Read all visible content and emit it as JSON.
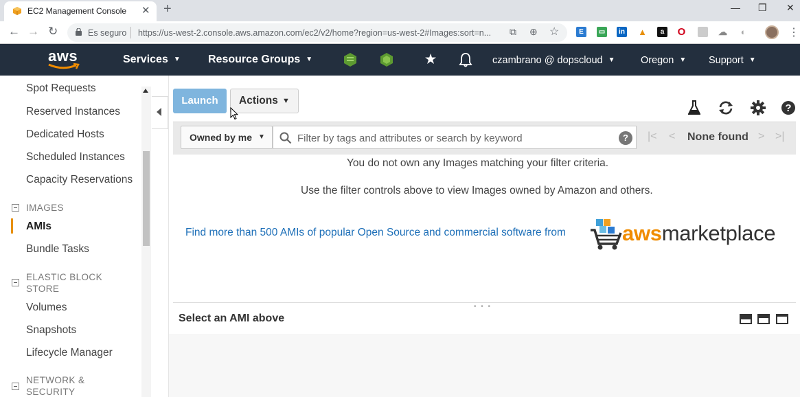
{
  "browser": {
    "tab_title": "EC2 Management Console",
    "tab_close": "✕",
    "new_tab": "+",
    "minimize": "—",
    "restore": "❐",
    "close": "✕",
    "secure_label": "Es seguro",
    "url": "https://us-west-2.console.aws.amazon.com/ec2/v2/home?region=us-west-2#Images:sort=n..."
  },
  "aws_nav": {
    "logo": "aws",
    "services": "Services",
    "resource_groups": "Resource Groups",
    "account": "czambrano @ dopscloud",
    "region": "Oregon",
    "support": "Support"
  },
  "sidebar": {
    "items_top": [
      {
        "label": "Spot Requests"
      },
      {
        "label": "Reserved Instances"
      },
      {
        "label": "Dedicated Hosts"
      },
      {
        "label": "Scheduled Instances"
      },
      {
        "label": "Capacity Reservations"
      }
    ],
    "images_section": "IMAGES",
    "images_items": [
      {
        "label": "AMIs"
      },
      {
        "label": "Bundle Tasks"
      }
    ],
    "ebs_section_line1": "ELASTIC BLOCK",
    "ebs_section_line2": "STORE",
    "ebs_items": [
      {
        "label": "Volumes"
      },
      {
        "label": "Snapshots"
      },
      {
        "label": "Lifecycle Manager"
      }
    ],
    "network_section_line1": "NETWORK &",
    "network_section_line2": "SECURITY"
  },
  "main": {
    "launch_label": "Launch",
    "actions_label": "Actions",
    "filter_owned": "Owned by me",
    "search_placeholder": "Filter by tags and attributes or search by keyword",
    "help_glyph": "?",
    "pager_status": "None found",
    "empty_line1": "You do not own any Images matching your filter criteria.",
    "empty_line2": "Use the filter controls above to view Images owned by Amazon and others.",
    "marketplace_link": "Find more than 500 AMIs of popular Open Source and commercial software from",
    "marketplace_aws": "aws",
    "marketplace_rest": "marketplace",
    "detail_title": "Select an AMI above"
  },
  "colors": {
    "aws_nav_bg": "#232f3e",
    "aws_orange": "#f08c00",
    "link_blue": "#1d6fb8",
    "launch_bg": "#7fb5de"
  }
}
